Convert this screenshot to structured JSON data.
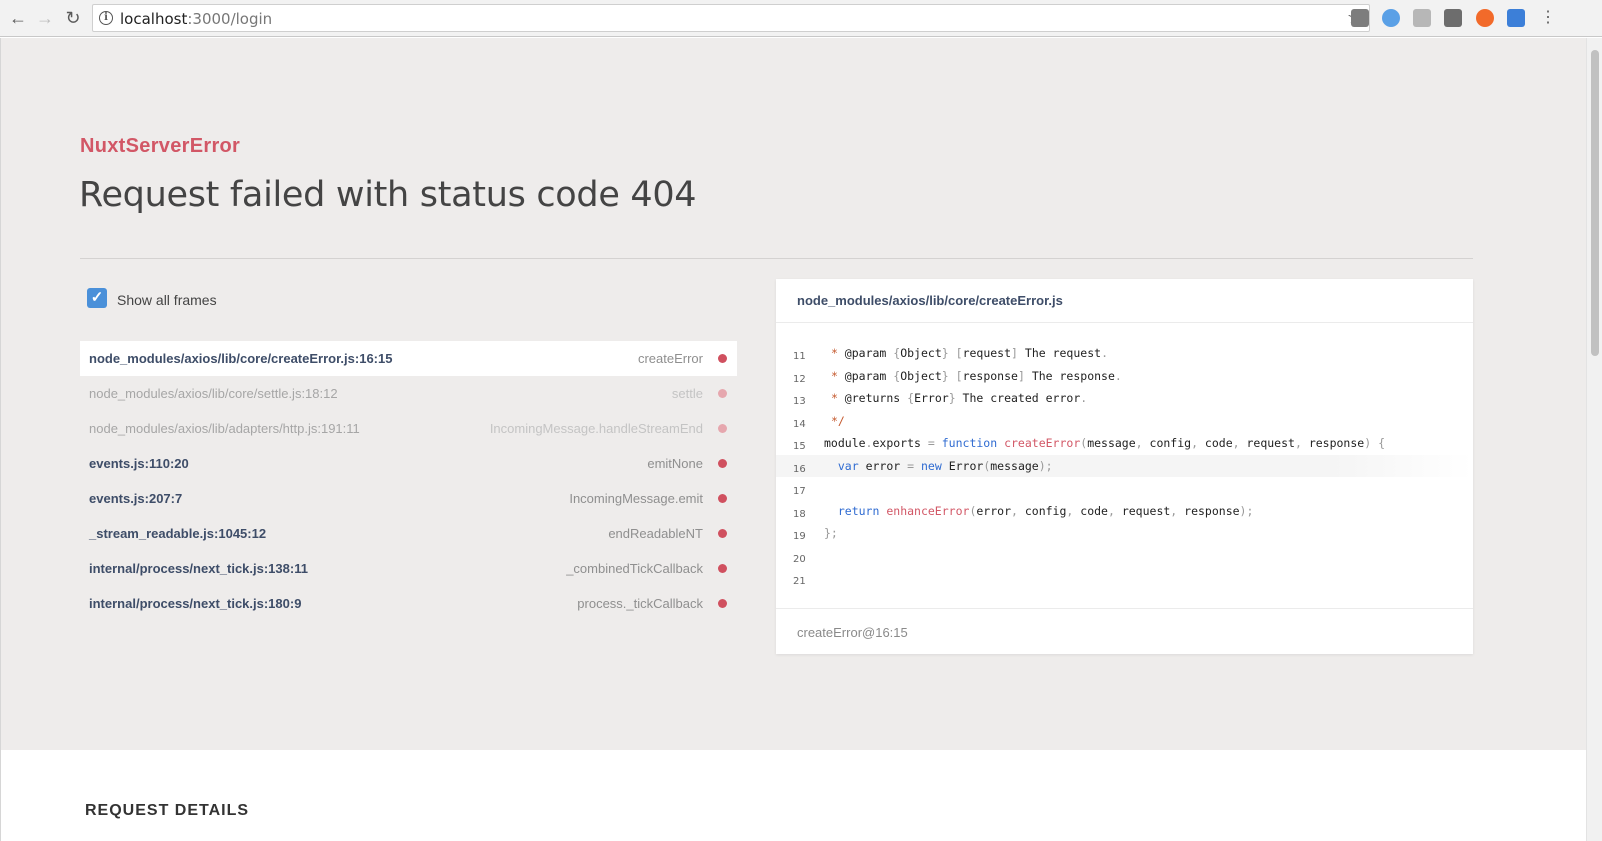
{
  "browser": {
    "url_host": "localhost",
    "url_path": ":3000/login"
  },
  "error": {
    "name": "NuxtServerError",
    "message": "Request failed with status code 404"
  },
  "frames_toggle": {
    "label": "Show all frames",
    "checked": true
  },
  "frames": [
    {
      "file": "node_modules/axios/lib/core/createError.js:16:15",
      "fn": "createError"
    },
    {
      "file": "node_modules/axios/lib/core/settle.js:18:12",
      "fn": "settle"
    },
    {
      "file": "node_modules/axios/lib/adapters/http.js:191:11",
      "fn": "IncomingMessage.handleStreamEnd"
    },
    {
      "file": "events.js:110:20",
      "fn": "emitNone"
    },
    {
      "file": "events.js:207:7",
      "fn": "IncomingMessage.emit"
    },
    {
      "file": "_stream_readable.js:1045:12",
      "fn": "endReadableNT"
    },
    {
      "file": "internal/process/next_tick.js:138:11",
      "fn": "_combinedTickCallback"
    },
    {
      "file": "internal/process/next_tick.js:180:9",
      "fn": "process._tickCallback"
    }
  ],
  "code_panel": {
    "file": "node_modules/axios/lib/core/createError.js",
    "footer": "createError@16:15",
    "line_numbers": [
      "11",
      "12",
      "13",
      "14",
      "15",
      "16",
      "17",
      "18",
      "19",
      "20",
      "21"
    ]
  },
  "request_details": {
    "title": "REQUEST DETAILS"
  },
  "colors": {
    "accent_red": "#d25766",
    "checkbox_blue": "#4a90d9",
    "keyword_blue": "#2f6bd1"
  }
}
